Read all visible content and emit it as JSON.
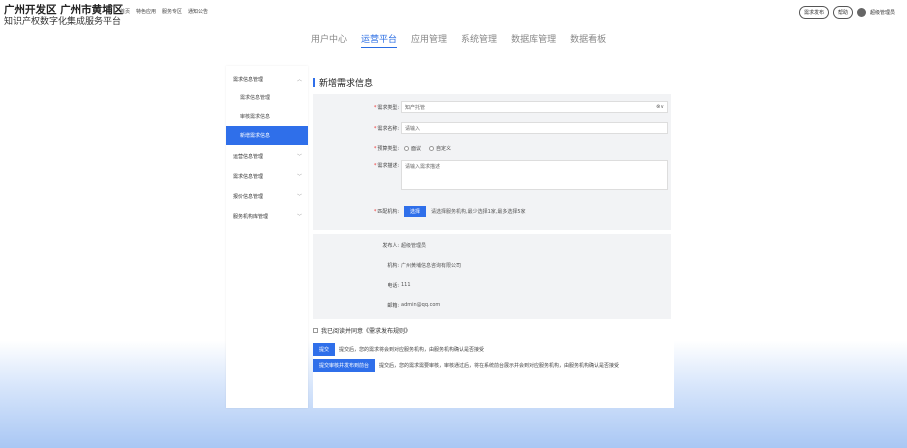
{
  "header": {
    "title": "广州开发区 广州市黄埔区",
    "subtitle": "知识产权数字化集成服务平台",
    "links": [
      "首页",
      "特色应用",
      "服务专区",
      "通知公告"
    ],
    "publish_btn": "需求发布",
    "help_btn": "帮助",
    "user": "超级管理员"
  },
  "nav": {
    "tabs": [
      "用户中心",
      "运营平台",
      "应用管理",
      "系统管理",
      "数据库管理",
      "数据看板"
    ],
    "active": "运营平台"
  },
  "sidebar": {
    "group_open": "需求信息管理",
    "subitems": [
      "需求信息管理",
      "审核需求信息",
      "新增需求信息"
    ],
    "groups": [
      "运营信息管理",
      "需求信息管理",
      "报价信息管理",
      "服务机构库管理"
    ]
  },
  "page": {
    "title": "新增需求信息",
    "form": {
      "type_label": "需求类型:",
      "type_value": "知产托管",
      "name_label": "需求名称:",
      "name_placeholder": "请输入",
      "budget_label": "预算类型:",
      "budget_options": [
        "面议",
        "自定义"
      ],
      "desc_label": "需求描述:",
      "desc_placeholder": "请输入需求描述",
      "org_label": "匹配机构:",
      "org_btn": "选择",
      "org_hint": "请选择服务机构,最少选择1家,最多选择5家"
    },
    "info": {
      "publisher_label": "发布人:",
      "publisher": "超级管理员",
      "org_label": "机构:",
      "org": "广州黄埔信息咨询有限公司",
      "phone_label": "电话:",
      "phone": "111",
      "email_label": "邮箱:",
      "email": "admin@qq.com"
    },
    "agree_text": "我已阅读并同意《需求发布规则》",
    "submit_btn": "提交",
    "submit_note": "提交后，您的需求将会到对应服务机构，由服务机构确认是否接受",
    "submit_review_btn": "提交审核并发布到前台",
    "submit_review_note": "提交后，您的需求需要审核，审核通过后，将在系统前台展示并会到对应服务机构，由服务机构确认是否接受"
  },
  "colors": {
    "accent": "#2f6fea"
  }
}
